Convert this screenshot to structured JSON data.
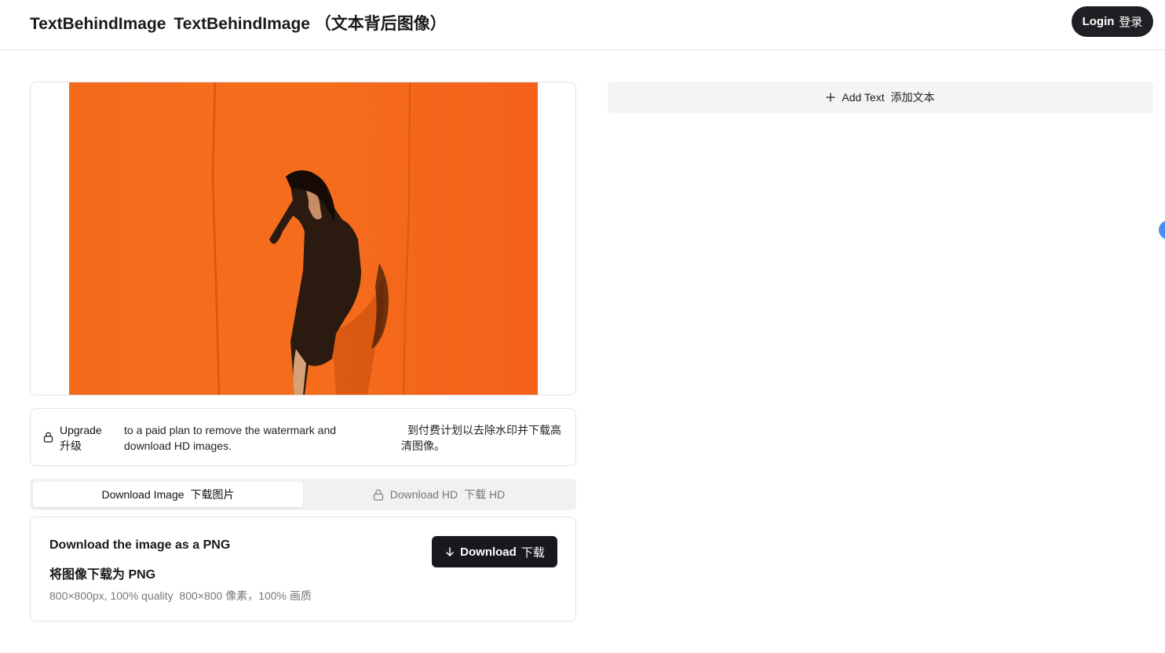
{
  "header": {
    "title_en": "TextBehindImage",
    "title_full": "TextBehindImage （文本背后图像）",
    "login_label": "Login",
    "login_label_zh": "登录"
  },
  "editor": {
    "add_text_label": "Add Text",
    "add_text_label_zh": "添加文本"
  },
  "upgrade": {
    "title": "Upgrade",
    "title_zh": "升级",
    "description": "to a paid plan to remove the watermark and download HD images.",
    "description_zh": "到付费计划以去除水印并下载高清图像。"
  },
  "tabs": [
    {
      "label": "Download Image",
      "label_zh": "下载图片"
    },
    {
      "label": "Download HD",
      "label_zh": "下载 HD"
    }
  ],
  "download": {
    "title": "Download the image as a PNG",
    "title_zh": "将图像下载为 PNG",
    "meta": "800×800px, 100% quality",
    "meta_zh": "800×800 像素，100% 画质",
    "button_label": "Download",
    "button_label_zh": "下载"
  },
  "colors": {
    "accent_dark": "#1f2023",
    "photo_background": "#f26a1b"
  },
  "icons": {
    "plus": "plus-icon",
    "lock": "lock-icon",
    "download_arrow": "arrow-down-icon"
  }
}
